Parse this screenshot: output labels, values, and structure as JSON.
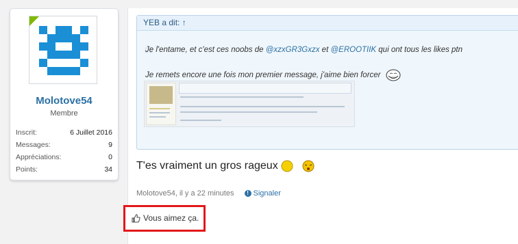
{
  "user": {
    "name": "Molotove54",
    "title": "Membre",
    "stats": [
      {
        "label": "Inscrit:",
        "value": "6 Juillet 2016"
      },
      {
        "label": "Messages:",
        "value": "9"
      },
      {
        "label": "Appréciations:",
        "value": "0"
      },
      {
        "label": "Points:",
        "value": "34"
      }
    ],
    "avatar_color": "#1b8fd6",
    "online_color": "#7fb900"
  },
  "quote": {
    "header": "YEB a dit: ↑",
    "line1_pre": "Je l'entame, et c'est ces noobs de ",
    "mention1": "@xzxGR3Gxzx",
    "line1_mid": " et ",
    "mention2": "@EROOTIIK",
    "line1_post": " qui ont tous les likes ptn",
    "line2": "Je remets encore une fois mon premier message, j'aime bien forcer"
  },
  "post": {
    "text": "T'es vraiment un gros rageux"
  },
  "meta": {
    "author_time": "Molotove54, il y a 22 minutes",
    "report": "Signaler"
  },
  "likes": {
    "text": "Vous aimez ça."
  },
  "colors": {
    "link": "#2c70a4",
    "highlight_border": "#e3171a"
  }
}
